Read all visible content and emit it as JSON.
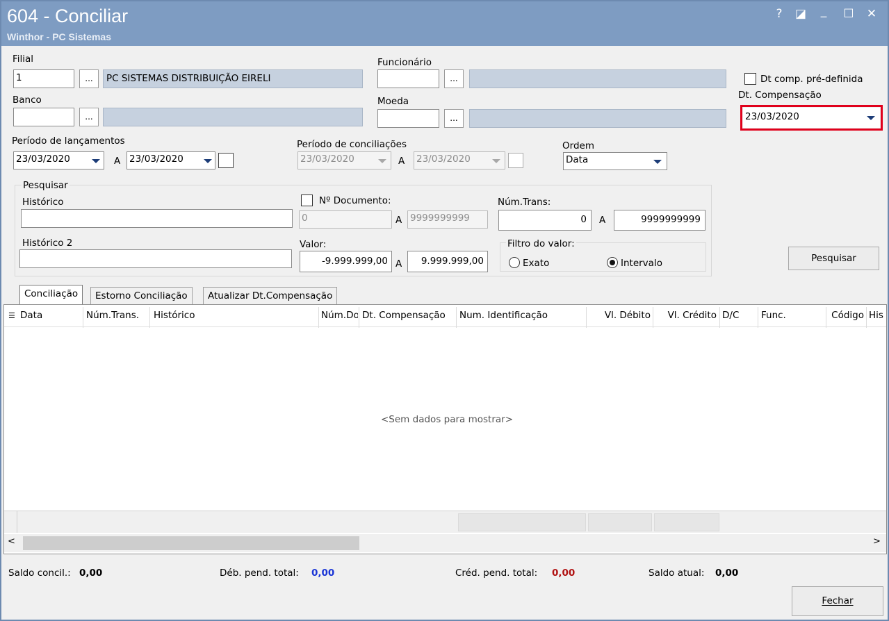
{
  "window": {
    "title": "604 - Conciliar",
    "subtitle": "Winthor - PC Sistemas",
    "controls": [
      "?",
      "◪",
      "_",
      "☐",
      "✕"
    ]
  },
  "form": {
    "filial": {
      "label": "Filial",
      "code": "1",
      "ellipsis": "...",
      "name": "PC SISTEMAS DISTRIBUIÇÃO  EIRELI"
    },
    "funcionario": {
      "label": "Funcionário",
      "code": "",
      "ellipsis": "...",
      "name": ""
    },
    "banco": {
      "label": "Banco",
      "code": "",
      "ellipsis": "...",
      "name": ""
    },
    "moeda": {
      "label": "Moeda",
      "code": "",
      "ellipsis": "...",
      "name": ""
    },
    "dt_comp_predefinida": {
      "label": "Dt comp. pré-definida",
      "checked": false
    },
    "dt_compensacao": {
      "label": "Dt. Compensação",
      "value": "23/03/2020",
      "highlight_color": "#e0001b"
    },
    "periodo_lancamentos": {
      "label": "Período de lançamentos",
      "from": "23/03/2020",
      "sep": "A",
      "to": "23/03/2020"
    },
    "periodo_conciliacoes": {
      "label": "Período de conciliações",
      "from": "23/03/2020",
      "sep": "A",
      "to": "23/03/2020",
      "disabled": true
    },
    "ordem": {
      "label": "Ordem",
      "value": "Data"
    }
  },
  "pesquisar": {
    "group_label": "Pesquisar",
    "historico": {
      "label": "Histórico",
      "value": ""
    },
    "historico2": {
      "label": "Histórico 2",
      "value": ""
    },
    "n_documento": {
      "label": "Nº Documento:",
      "checked": false,
      "from": "0",
      "sep": "A",
      "to": "9999999999"
    },
    "num_trans": {
      "label": "Núm.Trans:",
      "from": "0",
      "sep": "A",
      "to": "9999999999"
    },
    "valor": {
      "label": "Valor:",
      "from": "-9.999.999,00",
      "sep": "A",
      "to": "9.999.999,00"
    },
    "filtro_valor": {
      "label": "Filtro do valor:",
      "options": [
        "Exato",
        "Intervalo"
      ],
      "selected": "Intervalo"
    },
    "button": "Pesquisar"
  },
  "tabs": [
    {
      "label": "Conciliação",
      "active": true
    },
    {
      "label": "Estorno Conciliação",
      "active": false
    },
    {
      "label": "Atualizar Dt.Compensação",
      "active": false
    }
  ],
  "grid": {
    "columns": [
      "Data",
      "Núm.Trans.",
      "Histórico",
      "Núm.Do",
      "Dt. Compensação",
      "Num. Identificação",
      "Vl. Débito",
      "Vl. Crédito",
      "D/C",
      "Func.",
      "Código",
      "His"
    ],
    "empty_text": "<Sem dados para mostrar>"
  },
  "footer": {
    "saldo_concil": {
      "label": "Saldo concil.:",
      "value": "0,00",
      "color": "#000000"
    },
    "deb_pend_total": {
      "label": "Déb. pend. total:",
      "value": "0,00",
      "color": "#1a35d6"
    },
    "cred_pend_total": {
      "label": "Créd. pend. total:",
      "value": "0,00",
      "color": "#b01212"
    },
    "saldo_atual": {
      "label": "Saldo atual:",
      "value": "0,00",
      "color": "#000000"
    },
    "fechar_button": "Fechar"
  },
  "colors": {
    "titlebar": "#7e9cc2",
    "readonly_field": "#c6d1df",
    "highlight": "#e0001b"
  }
}
